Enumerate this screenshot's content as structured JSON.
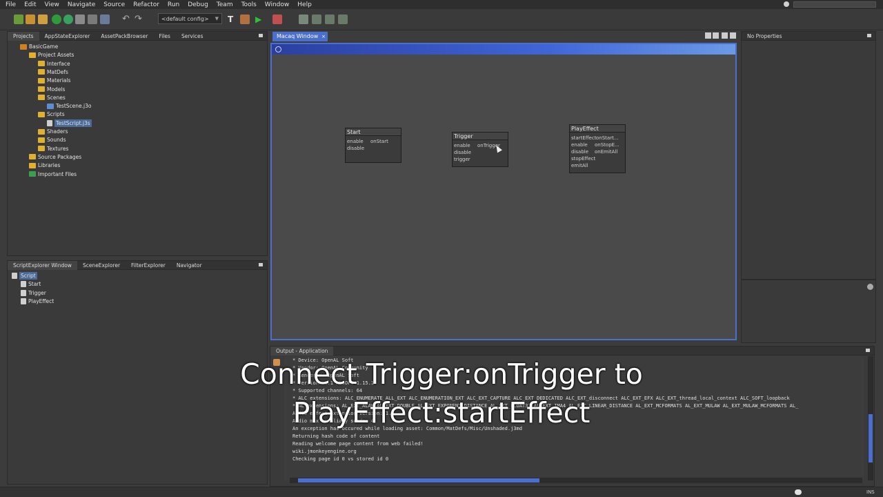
{
  "menubar": [
    "File",
    "Edit",
    "View",
    "Navigate",
    "Source",
    "Refactor",
    "Run",
    "Debug",
    "Team",
    "Tools",
    "Window",
    "Help"
  ],
  "toolbar": {
    "config": "<default config>"
  },
  "projects_panel": {
    "tabs": [
      "Projects",
      "AppStateExplorer",
      "AssetPackBrowser",
      "Files",
      "Services"
    ],
    "tree": [
      {
        "label": "BasicGame",
        "indent": 0,
        "icon": "project-icon"
      },
      {
        "label": "Project Assets",
        "indent": 1,
        "icon": "assets-icon"
      },
      {
        "label": "Interface",
        "indent": 2,
        "icon": "folder-icon"
      },
      {
        "label": "MatDefs",
        "indent": 2,
        "icon": "folder-icon"
      },
      {
        "label": "Materials",
        "indent": 2,
        "icon": "folder-icon"
      },
      {
        "label": "Models",
        "indent": 2,
        "icon": "folder-icon"
      },
      {
        "label": "Scenes",
        "indent": 2,
        "icon": "folder-icon"
      },
      {
        "label": "TestScene.j3o",
        "indent": 3,
        "icon": "scene-file-icon"
      },
      {
        "label": "Scripts",
        "indent": 2,
        "icon": "folder-icon"
      },
      {
        "label": "TestScript.j3s",
        "indent": 3,
        "icon": "script-file-icon",
        "selected": true
      },
      {
        "label": "Shaders",
        "indent": 2,
        "icon": "folder-icon"
      },
      {
        "label": "Sounds",
        "indent": 2,
        "icon": "folder-icon"
      },
      {
        "label": "Textures",
        "indent": 2,
        "icon": "folder-icon"
      },
      {
        "label": "Source Packages",
        "indent": 1,
        "icon": "package-icon"
      },
      {
        "label": "Libraries",
        "indent": 1,
        "icon": "library-icon"
      },
      {
        "label": "Important Files",
        "indent": 1,
        "icon": "important-files-icon"
      }
    ]
  },
  "script_panel": {
    "tabs": [
      "ScriptExplorer Window",
      "SceneExplorer",
      "FilterExplorer",
      "Navigator"
    ],
    "tree": [
      {
        "label": "Script",
        "indent": 0,
        "selected": true
      },
      {
        "label": "Start",
        "indent": 1
      },
      {
        "label": "Trigger",
        "indent": 1
      },
      {
        "label": "PlayEffect",
        "indent": 1
      }
    ]
  },
  "editor": {
    "tab_label": "Macaq Window",
    "nodes": [
      {
        "title": "Start",
        "left_pins": [
          "enable",
          "disable"
        ],
        "right_pins": [
          "onStart"
        ]
      },
      {
        "title": "Trigger",
        "left_pins": [
          "enable",
          "disable",
          "trigger"
        ],
        "right_pins": [
          "onTrigger"
        ]
      },
      {
        "title": "PlayEffect",
        "left_pins": [
          "startEffect",
          "enable",
          "disable",
          "stopEffect",
          "emitAll"
        ],
        "right_pins": [
          "onStart...",
          "onStopE...",
          "onEmitAll"
        ]
      }
    ]
  },
  "properties_panel": {
    "title": "No Properties"
  },
  "output_panel": {
    "title": "Output - Application",
    "lines": [
      " * Device: OpenAL Soft",
      " * Vendor: OpenAL Community",
      " * Renderer: OpenAL Soft",
      " * Version: 1.1 ALSOFT 1.15.1",
      " * Supported channels: 64",
      " * ALC extensions: ALC_ENUMERATE_ALL_EXT ALC_ENUMERATION_EXT ALC_EXT_CAPTURE ALC_EXT_DEDICATED ALC_EXT_disconnect ALC_EXT_EFX ALC_EXT_thread_local_context ALC_SOFT_loopback",
      " * AL extensions: AL_EXT_ALAW AL_EXT_DOUBLE AL_EXT_EXPONENT_DISTANCE AL_EXT_FLOAT32 AL_EXT_IMA4 AL_EXT_LINEAR_DISTANCE AL_EXT_MCFORMATS AL_EXT_MULAW AL_EXT_MULAW_MCFORMATS AL_",
      "Audio effect extension version: 1.0",
      "Audio max auxiliary sends: 4",
      "An exception has occured while loading asset: Common/MatDefs/Misc/Unshaded.j3md",
      "Returning hash code of content",
      "Reading welcome page content from web failed!",
      "wiki.jmonkeyengine.org",
      "Checking page id 0 vs stored id 0"
    ]
  },
  "caption": {
    "line1": "Connect Trigger:onTrigger to",
    "line2": "PlayEffect:startEffect"
  },
  "status": {
    "mode": "INS"
  }
}
